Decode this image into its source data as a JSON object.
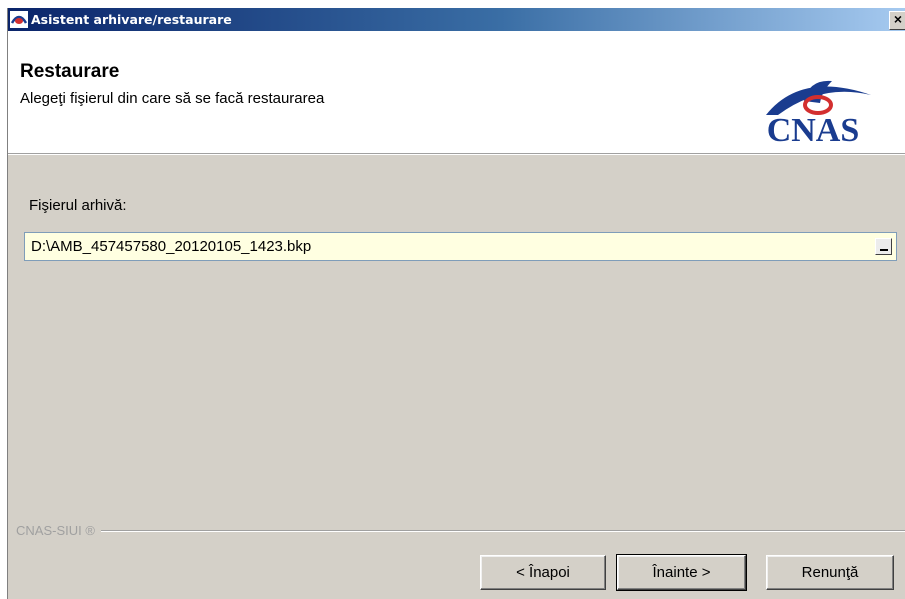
{
  "window": {
    "title": "Asistent arhivare/restaurare",
    "close_glyph": "×"
  },
  "header": {
    "title": "Restaurare",
    "subtitle": "Alegeţi fişierul din care să se facă restaurarea",
    "logo_text": "CNAS"
  },
  "form": {
    "file_label": "Fişierul arhivă:",
    "file_value": "D:\\AMB_457457580_20120105_1423.bkp"
  },
  "footer": {
    "brand": "CNAS-SIUI ®",
    "buttons": {
      "back": "< Înapoi",
      "next": "Înainte >",
      "cancel": "Renunţă"
    }
  },
  "colors": {
    "title_bar": "#0a246a",
    "dialog_bg": "#d4d0c8",
    "field_bg": "#ffffe1",
    "logo_blue": "#1a3c8f",
    "logo_red": "#d32f2f"
  }
}
